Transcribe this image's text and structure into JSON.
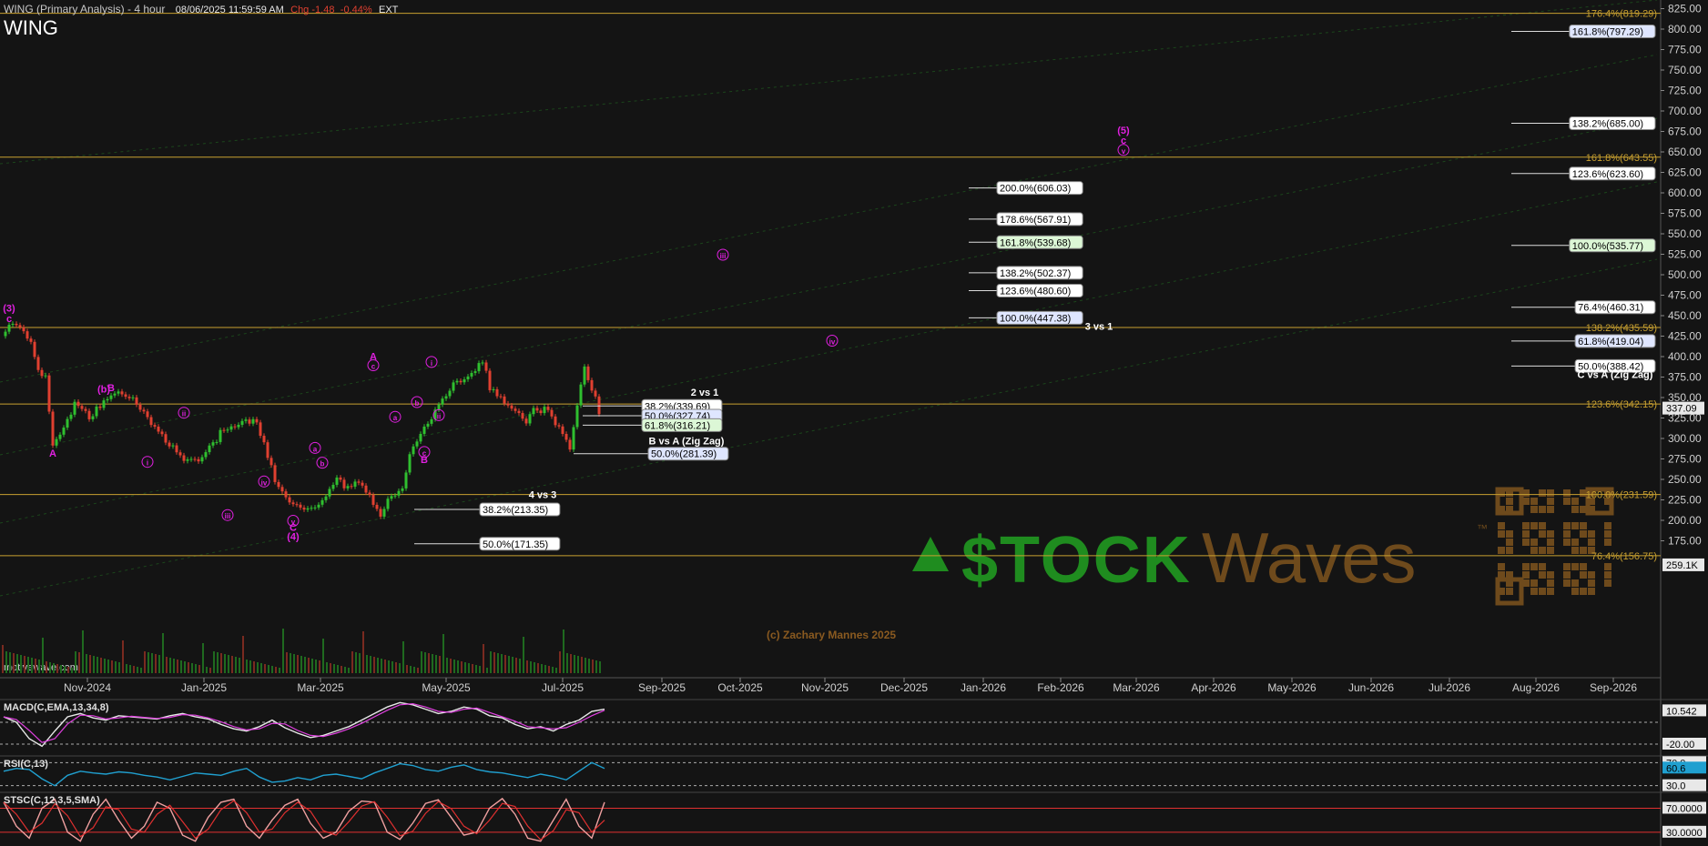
{
  "header": {
    "title": "WING (Primary Analysis) - 4 hour",
    "datetime": "08/06/2025 11:59:59 AM",
    "change": "Chg -1.48",
    "change_pct": "-0.44%",
    "session": "EXT",
    "symbol": "WING"
  },
  "watermarks": {
    "site": "motivewave.com",
    "copyright": "(c) Zachary Mannes 2025",
    "brand_left": "$TOCK",
    "brand_right": "Waves",
    "tm": "™"
  },
  "colors": {
    "background": "#141414",
    "up_candle": "#2fbf2f",
    "down_candle": "#e04030",
    "fib_line": "#c8a030",
    "wave_label": "#e020e0",
    "brand_green": "#1f8c1f",
    "brand_brown": "#6e4a1c",
    "macd": "#e8e8e8",
    "signal": "#e040e0",
    "rsi": "#20a0d0",
    "stoch_k": "#f0a0a0",
    "stoch_d": "#e03030"
  },
  "chart_data": [
    {
      "type": "candlestick",
      "title": "WING (Primary Analysis) - 4 hour",
      "price_axis": {
        "ylim": [
          150,
          830
        ],
        "ticks": [
          175,
          200,
          225,
          250,
          275,
          300,
          325,
          350,
          375,
          400,
          425,
          450,
          475,
          500,
          525,
          550,
          575,
          600,
          625,
          650,
          675,
          700,
          725,
          750,
          775,
          800,
          825
        ],
        "current_price": "337.09",
        "volume_label": "259.1K"
      },
      "time_axis": {
        "labels": [
          "Nov-2024",
          "Jan-2025",
          "Mar-2025",
          "May-2025",
          "Jul-2025",
          "Sep-2025",
          "Oct-2025",
          "Nov-2025",
          "Dec-2025",
          "Jan-2026",
          "Feb-2026",
          "Mar-2026",
          "Apr-2026",
          "May-2026",
          "Jun-2026",
          "Jul-2026",
          "Aug-2026",
          "Sep-2026"
        ]
      },
      "price_path": [
        [
          0,
          425
        ],
        [
          2,
          438
        ],
        [
          4,
          415
        ],
        [
          5,
          380
        ],
        [
          6,
          372
        ],
        [
          7,
          290
        ],
        [
          8,
          310
        ],
        [
          10,
          345
        ],
        [
          12,
          330
        ],
        [
          14,
          348
        ],
        [
          16,
          350
        ],
        [
          18,
          345
        ],
        [
          20,
          320
        ],
        [
          22,
          300
        ],
        [
          24,
          290
        ],
        [
          25,
          278
        ],
        [
          27,
          280
        ],
        [
          29,
          300
        ],
        [
          31,
          305
        ],
        [
          33,
          318
        ],
        [
          35,
          315
        ],
        [
          37,
          260
        ],
        [
          39,
          230
        ],
        [
          41,
          216
        ],
        [
          43,
          222
        ],
        [
          45,
          232
        ],
        [
          46,
          250
        ],
        [
          47,
          235
        ],
        [
          49,
          245
        ],
        [
          51,
          218
        ],
        [
          52,
          206
        ],
        [
          53,
          230
        ],
        [
          55,
          240
        ],
        [
          56,
          285
        ],
        [
          58,
          320
        ],
        [
          60,
          340
        ],
        [
          62,
          362
        ],
        [
          64,
          375
        ],
        [
          66,
          388
        ],
        [
          67,
          365
        ],
        [
          69,
          348
        ],
        [
          71,
          335
        ],
        [
          72,
          325
        ],
        [
          73,
          345
        ],
        [
          75,
          330
        ],
        [
          77,
          300
        ],
        [
          78,
          285
        ],
        [
          79,
          340
        ],
        [
          80,
          382
        ],
        [
          81,
          355
        ],
        [
          82,
          337
        ]
      ],
      "fib_lines": [
        {
          "label": "176.4%(819.29)",
          "price": 819.29
        },
        {
          "label": "161.8%(643.55)",
          "price": 643.55
        },
        {
          "label": "138.2%(435.59)",
          "price": 435.59
        },
        {
          "label": "123.6%(342.15)",
          "price": 342.15
        },
        {
          "label": "100.0%(231.59)",
          "price": 231.59
        },
        {
          "label": "76.4%(156.75)",
          "price": 156.75
        }
      ],
      "fib_boxes": [
        {
          "label": "161.8%(797.29)",
          "price": 797.29,
          "style": "blue",
          "anchor": "right"
        },
        {
          "label": "138.2%(685.00)",
          "price": 685.0,
          "style": "white",
          "anchor": "right"
        },
        {
          "label": "123.6%(623.60)",
          "price": 623.6,
          "style": "white",
          "anchor": "right"
        },
        {
          "label": "100.0%(535.77)",
          "price": 535.77,
          "style": "green",
          "anchor": "right"
        },
        {
          "label": "76.4%(460.31)",
          "price": 460.31,
          "style": "white",
          "anchor": "right"
        },
        {
          "label": "61.8%(419.04)",
          "price": 419.04,
          "style": "blue",
          "anchor": "right"
        },
        {
          "label": "50.0%(388.42)",
          "price": 388.42,
          "style": "white",
          "anchor": "right"
        },
        {
          "label": "200.0%(606.03)",
          "price": 606.03,
          "style": "white",
          "anchor": "mid"
        },
        {
          "label": "178.6%(567.91)",
          "price": 567.91,
          "style": "white",
          "anchor": "mid"
        },
        {
          "label": "161.8%(539.68)",
          "price": 539.68,
          "style": "green",
          "anchor": "mid"
        },
        {
          "label": "138.2%(502.37)",
          "price": 502.37,
          "style": "white",
          "anchor": "mid"
        },
        {
          "label": "123.6%(480.60)",
          "price": 480.6,
          "style": "white",
          "anchor": "mid"
        },
        {
          "label": "100.0%(447.38)",
          "price": 447.38,
          "style": "blue",
          "anchor": "mid"
        },
        {
          "label": "38.2%(339.69)",
          "price": 339.69,
          "style": "white",
          "anchor": "left2"
        },
        {
          "label": "50.0%(327.74)",
          "price": 327.74,
          "style": "blue",
          "anchor": "left2"
        },
        {
          "label": "61.8%(316.21)",
          "price": 316.21,
          "style": "green",
          "anchor": "left2"
        },
        {
          "label": "50.0%(281.39)",
          "price": 281.39,
          "style": "blue",
          "anchor": "left3"
        },
        {
          "label": "38.2%(213.35)",
          "price": 213.35,
          "style": "white",
          "anchor": "left1"
        },
        {
          "label": "50.0%(171.35)",
          "price": 171.35,
          "style": "white",
          "anchor": "left1"
        }
      ],
      "group_labels": [
        {
          "text": "2 vs 1",
          "price": 352
        },
        {
          "text": "B vs A (Zig Zag)",
          "price": 293
        },
        {
          "text": "4 vs 3",
          "price": 227
        },
        {
          "text": "3 vs 1",
          "price": 433
        },
        {
          "text": "C vs A (Zig Zag)",
          "price": 374
        }
      ],
      "wave_labels": [
        {
          "text": "(3)",
          "bar": 1,
          "price": 455
        },
        {
          "text": "c",
          "bar": 1,
          "price": 442
        },
        {
          "text": "A",
          "bar": 7,
          "price": 278
        },
        {
          "text": "(b)",
          "bar": 14,
          "price": 356
        },
        {
          "text": "B",
          "bar": 15,
          "price": 358
        },
        {
          "text": "i",
          "bar": 20,
          "price": 267
        },
        {
          "text": "ii",
          "bar": 25,
          "price": 327
        },
        {
          "text": "iii",
          "bar": 31,
          "price": 202
        },
        {
          "text": "iv",
          "bar": 36,
          "price": 243
        },
        {
          "text": "v",
          "bar": 40,
          "price": 195
        },
        {
          "text": "C",
          "bar": 40,
          "price": 187
        },
        {
          "text": "(4)",
          "bar": 40,
          "price": 176
        },
        {
          "text": "a",
          "bar": 43,
          "price": 284
        },
        {
          "text": "b",
          "bar": 44,
          "price": 266
        },
        {
          "text": "A",
          "bar": 51,
          "price": 396
        },
        {
          "text": "c",
          "bar": 51,
          "price": 385
        },
        {
          "text": "a",
          "bar": 54,
          "price": 322
        },
        {
          "text": "b",
          "bar": 57,
          "price": 340
        },
        {
          "text": "i",
          "bar": 59,
          "price": 389
        },
        {
          "text": "ii",
          "bar": 60,
          "price": 324
        },
        {
          "text": "c",
          "bar": 58,
          "price": 279
        },
        {
          "text": "B",
          "bar": 58,
          "price": 270
        },
        {
          "text": "iii",
          "bar": 99,
          "price": 520
        },
        {
          "text": "iv",
          "bar": 114,
          "price": 415
        },
        {
          "text": "(5)",
          "bar": 154,
          "price": 672
        },
        {
          "text": "c",
          "bar": 154,
          "price": 660
        },
        {
          "text": "v",
          "bar": 154,
          "price": 648
        }
      ]
    },
    {
      "type": "line",
      "title": "MACD(C,EMA,13,34,8)",
      "labels": [
        "10.542",
        "-20.00"
      ],
      "series": [
        {
          "values": [
            5,
            0,
            -15,
            -22,
            -8,
            5,
            8,
            4,
            2,
            6,
            5,
            4,
            3,
            6,
            8,
            5,
            3,
            -2,
            -6,
            -8,
            -4,
            2,
            -5,
            -10,
            -14,
            -12,
            -8,
            -4,
            2,
            8,
            14,
            18,
            16,
            12,
            8,
            10,
            14,
            12,
            6,
            4,
            -2,
            -6,
            -4,
            -8,
            -2,
            2,
            10,
            12
          ]
        }
      ]
    },
    {
      "type": "line",
      "title": "RSI(C,13)",
      "labels": [
        "70.0",
        "60.6",
        "30.0"
      ],
      "series": [
        {
          "values": [
            55,
            60,
            58,
            42,
            30,
            48,
            55,
            52,
            50,
            54,
            52,
            48,
            45,
            40,
            46,
            52,
            50,
            48,
            55,
            60,
            45,
            36,
            38,
            44,
            40,
            48,
            50,
            46,
            42,
            52,
            60,
            68,
            65,
            58,
            55,
            62,
            66,
            58,
            54,
            52,
            48,
            44,
            50,
            46,
            40,
            55,
            70,
            60
          ]
        }
      ]
    },
    {
      "type": "line",
      "title": "STSC(C,12,3,5,SMA)",
      "labels": [
        "70.0000",
        "30.0000"
      ],
      "series": [
        {
          "values": [
            80,
            40,
            20,
            70,
            85,
            30,
            15,
            60,
            85,
            50,
            20,
            40,
            80,
            70,
            25,
            15,
            55,
            80,
            85,
            40,
            20,
            50,
            75,
            85,
            45,
            20,
            30,
            65,
            82,
            80,
            30,
            18,
            45,
            78,
            84,
            55,
            25,
            30,
            70,
            86,
            60,
            20,
            15,
            50,
            85,
            40,
            20,
            80
          ]
        }
      ]
    }
  ]
}
